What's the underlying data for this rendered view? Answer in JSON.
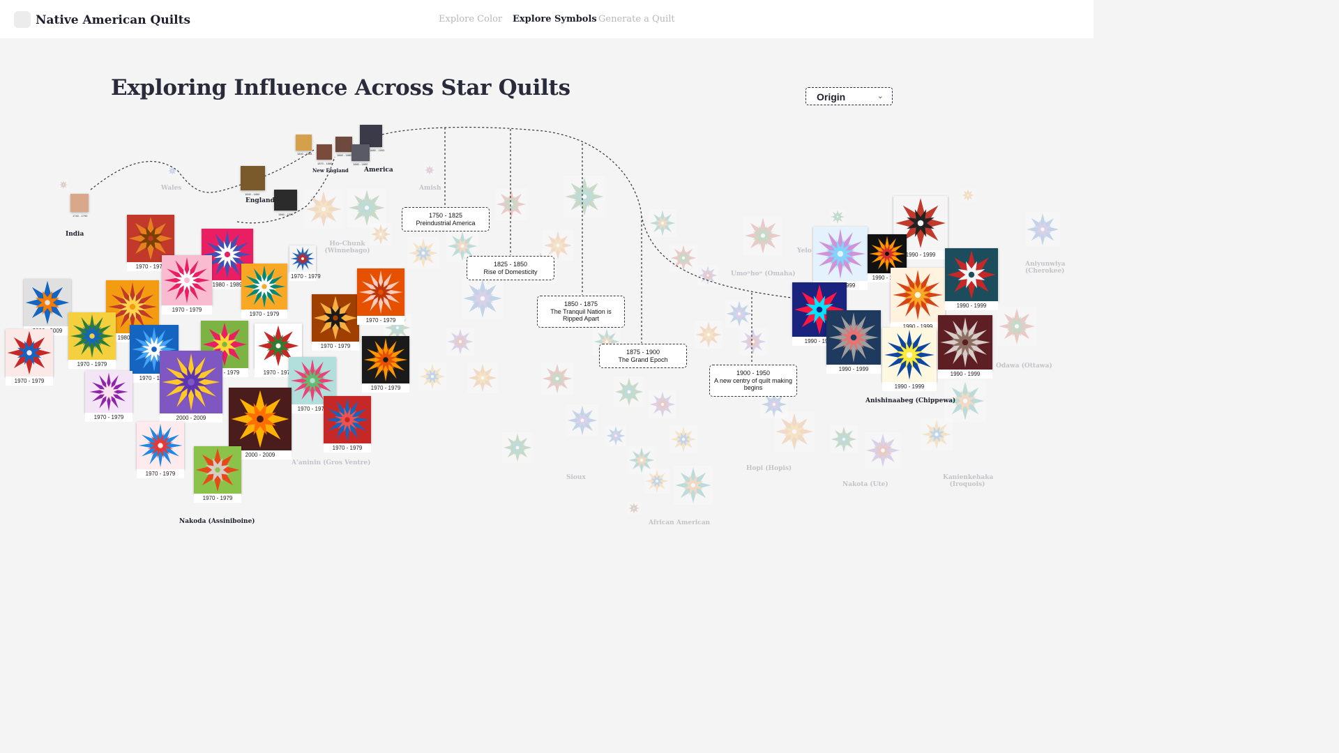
{
  "app": {
    "title": "Native American Quilts"
  },
  "nav": {
    "items": [
      {
        "label": "Explore Color",
        "active": false
      },
      {
        "label": "Explore Symbols",
        "active": true
      },
      {
        "label": "Generate a Quilt",
        "active": false
      }
    ]
  },
  "page": {
    "title": "Exploring Influence Across Star Quilts"
  },
  "filter": {
    "selected": "Origin",
    "icon": "chevron-down-icon"
  },
  "regions": {
    "india": "India",
    "england": "England",
    "new_england": "New England",
    "america": "America",
    "nakoda": "Nakoda (Assiniboine)",
    "anishinaabeg": "Anishinaabeg (Chippewa)"
  },
  "ghost_labels": {
    "wales": "Wales",
    "amish": "Amish",
    "hochunk": "Ho-Chunk (Winnebago)",
    "yelo": "Yelo",
    "umonhon": "Umoⁿhoⁿ (Omaha)",
    "aniyunwiya": "Aniyunwiya (Cherokee)",
    "odawa": "Odawa (Ottawa)",
    "aaniiih": "A'aninin (Gros Ventre)",
    "sioux": "Sioux",
    "hopi": "Hopi (Hopis)",
    "nakota": "Nakota (Ute)",
    "kanienkeha": "Kanienkehaka (Iroquois)",
    "african": "African American"
  },
  "eras": [
    {
      "range": "1750 - 1825",
      "name": "Preindustrial America"
    },
    {
      "range": "1825 - 1850",
      "name": "Rise of Domesticity"
    },
    {
      "range": "1850 - 1875",
      "name": "The Tranquil Nation is Ripped Apart"
    },
    {
      "range": "1875 - 1900",
      "name": "The Grand Epoch"
    },
    {
      "range": "1900 - 1950",
      "name": "A new centry of quilt making begins"
    }
  ],
  "early_captions": {
    "india": "1740 - 1790",
    "england_a": "1840 - 1860",
    "england_b": "1860 - 1870",
    "ne_a": "1840 - 1868",
    "ne_b": "1870 - 1880",
    "ne_c": "1860 - 1880",
    "am_a": "1880 - 1900",
    "am_b": "1880 - 1890"
  },
  "nakoda_quilts": [
    {
      "caption": "1970 - 1979",
      "colors": [
        "#c0392b",
        "#e67e22",
        "#7b3f00"
      ]
    },
    {
      "caption": "1980 - 1989",
      "colors": [
        "#e91e63",
        "#3f51b5",
        "#ffffff"
      ]
    },
    {
      "caption": "1970 - 1979",
      "colors": [
        "#f8bbd0",
        "#e91e63",
        "#ffffff"
      ]
    },
    {
      "caption": "2000 - 2009",
      "colors": [
        "#e0e0e0",
        "#1565c0",
        "#f57c00"
      ]
    },
    {
      "caption": "1980 - 1989",
      "colors": [
        "#f39c12",
        "#c0392b",
        "#ffd54f"
      ]
    },
    {
      "caption": "1970 - 1979",
      "colors": [
        "#f9a825",
        "#00897b",
        "#ffffff"
      ]
    },
    {
      "caption": "1970 - 1979",
      "colors": [
        "#fbe9e7",
        "#c62828",
        "#1565c0"
      ]
    },
    {
      "caption": "1970 - 1979",
      "colors": [
        "#f4d03f",
        "#2e7d32",
        "#1565c0"
      ]
    },
    {
      "caption": "1970 - 1979",
      "colors": [
        "#1565c0",
        "#42a5f5",
        "#ffffff"
      ]
    },
    {
      "caption": "1970 - 1979",
      "colors": [
        "#7cb342",
        "#e91e63",
        "#fdd835"
      ]
    },
    {
      "caption": "2000 - 2009",
      "colors": [
        "#7e57c2",
        "#ffca28",
        "#5e35b1"
      ]
    },
    {
      "caption": "1970 - 1979",
      "colors": [
        "#f3e5f5",
        "#8e24aa",
        "#fce4ec"
      ]
    },
    {
      "caption": "1970 - 1979",
      "colors": [
        "#ffffff",
        "#c62828",
        "#2e7d32"
      ]
    },
    {
      "caption": "1970 - 1979",
      "colors": [
        "#ffebee",
        "#1e88e5",
        "#e53935"
      ]
    },
    {
      "caption": "1970 - 1979",
      "colors": [
        "#b2dfdb",
        "#ec407a",
        "#66bb6a"
      ]
    },
    {
      "caption": "1970 - 1979",
      "colors": [
        "#a04000",
        "#f5b041",
        "#1a1a1a"
      ]
    },
    {
      "caption": "1970 - 1979",
      "colors": [
        "#e65100",
        "#ffccbc",
        "#bf360c"
      ]
    },
    {
      "caption": "1970 - 1979",
      "colors": [
        "#1a1a1a",
        "#ff9800",
        "#e65100"
      ]
    },
    {
      "caption": "2000 - 2009",
      "colors": [
        "#4a1c1c",
        "#ffb300",
        "#ff6f00"
      ]
    },
    {
      "caption": "1970 - 1979",
      "colors": [
        "#c62828",
        "#1565c0",
        "#ef5350"
      ]
    },
    {
      "caption": "1970 - 1979",
      "colors": [
        "#1565c0",
        "#e53935",
        "#ffffff"
      ]
    },
    {
      "caption": "1970 - 1979",
      "colors": [
        "#8bc34a",
        "#e64a19",
        "#d7ccc8"
      ]
    },
    {
      "caption": "1970 - 1979",
      "colors": [
        "#f5f5f5",
        "#1565c0",
        "#c62828"
      ]
    }
  ],
  "anishinaabeg_quilts": [
    {
      "caption": "1990 - 1999",
      "colors": [
        "#f5f5f5",
        "#c0392b",
        "#222222"
      ]
    },
    {
      "caption": "1990 - 1999",
      "colors": [
        "#e3f2fd",
        "#ce93d8",
        "#81d4fa"
      ]
    },
    {
      "caption": "1990 - 1999",
      "colors": [
        "#111111",
        "#ff9800",
        "#d32f2f"
      ]
    },
    {
      "caption": "1990 - 1999",
      "colors": [
        "#1a237e",
        "#ff1744",
        "#00e5ff"
      ]
    },
    {
      "caption": "1990 - 1999",
      "colors": [
        "#1e3a5f",
        "#9e9e9e",
        "#e57373"
      ]
    },
    {
      "caption": "1990 - 1999",
      "colors": [
        "#fff3e0",
        "#d84315",
        "#f9a825"
      ]
    },
    {
      "caption": "1990 - 1999",
      "colors": [
        "#1b4d5c",
        "#c62828",
        "#f5f5f5"
      ]
    },
    {
      "caption": "1990 - 1999",
      "colors": [
        "#fff8e1",
        "#0d47a1",
        "#ffeb3b"
      ]
    },
    {
      "caption": "1990 - 1999",
      "colors": [
        "#5d1f24",
        "#d7ccc8",
        "#8d6e63"
      ]
    }
  ]
}
